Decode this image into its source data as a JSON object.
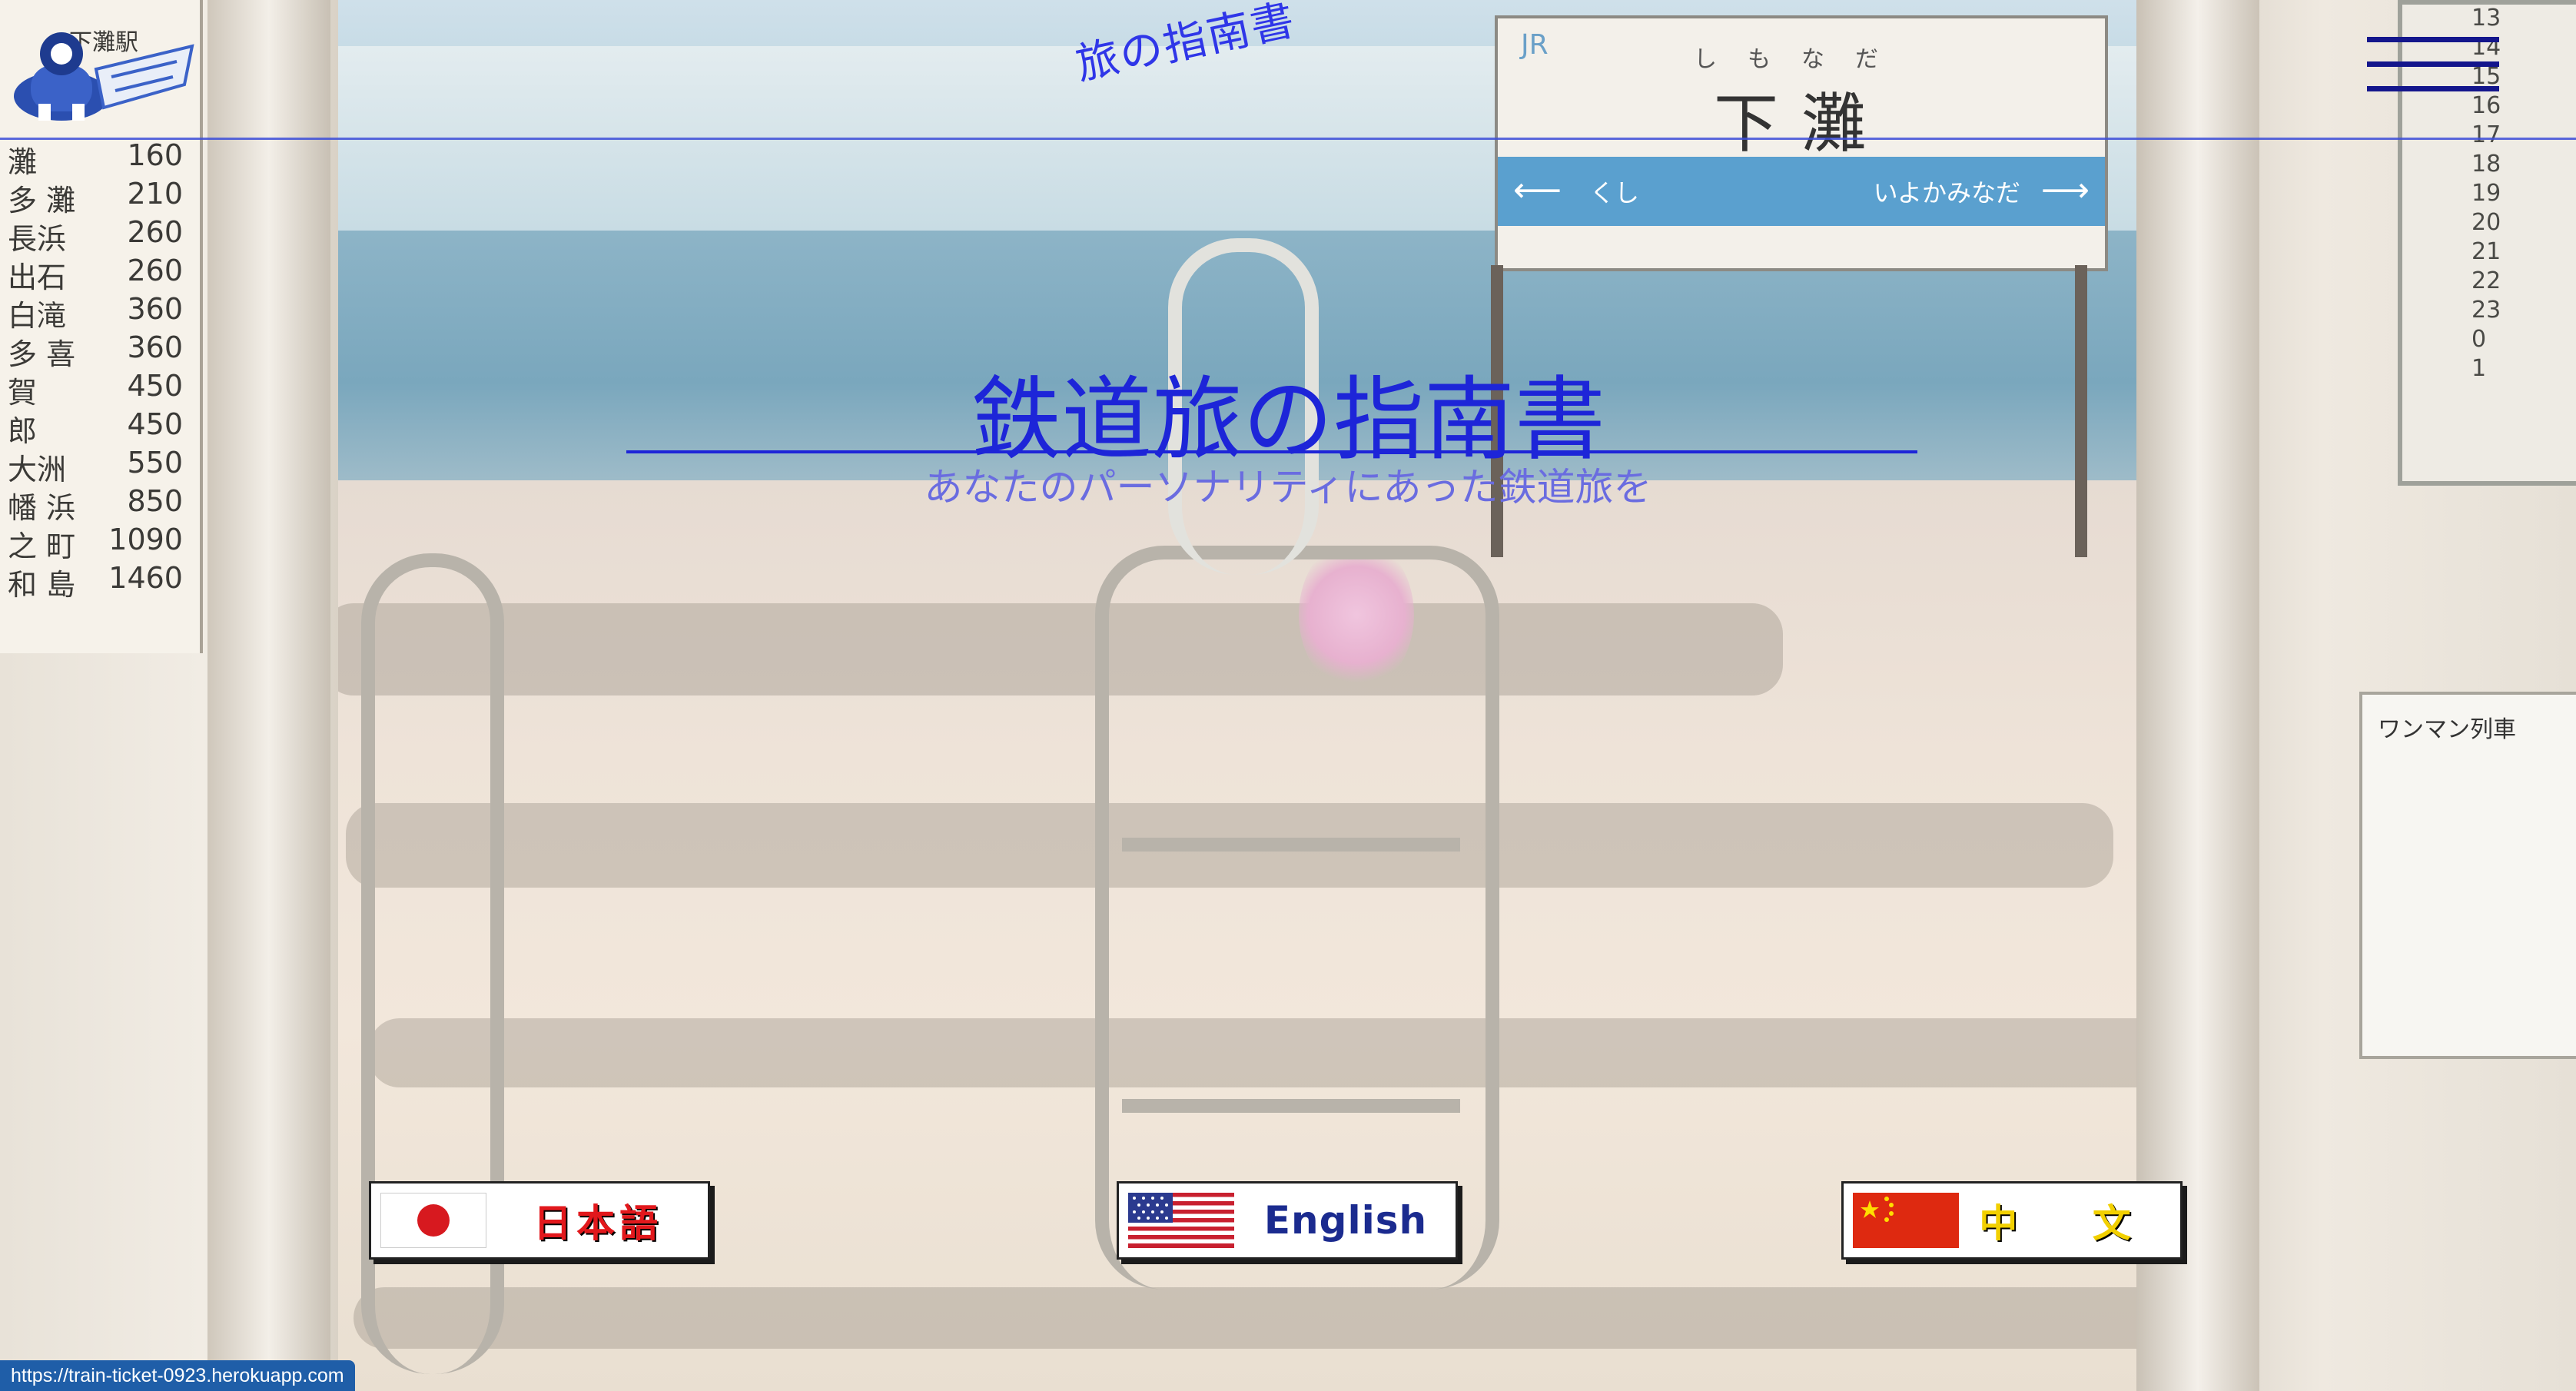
{
  "header": {
    "site_title": "旅の指南書",
    "menu_label": "メニュー"
  },
  "hero": {
    "title": "鉄道旅の指南書",
    "subtitle": "あなたのパーソナリティにあった鉄道旅を"
  },
  "languages": [
    {
      "label": "日本語",
      "flag": "japan-flag-icon"
    },
    {
      "label": "English",
      "flag": "usa-flag-icon"
    },
    {
      "label": "中 文",
      "flag": "china-flag-icon"
    }
  ],
  "background": {
    "station_sign": {
      "name": "下灘",
      "reading": "しもなだ",
      "line_mark": "JR",
      "left_dest": "くし",
      "right_dest": "いよかみなだ"
    },
    "fare_board": {
      "station": "下灘駅",
      "rows": [
        {
          "name": "灘",
          "fare": "160"
        },
        {
          "name": "多 灘",
          "fare": "210"
        },
        {
          "name": "長浜",
          "fare": "260"
        },
        {
          "name": "出石",
          "fare": "260"
        },
        {
          "name": "白滝",
          "fare": "360"
        },
        {
          "name": "多 喜",
          "fare": "360"
        },
        {
          "name": "賀",
          "fare": "450"
        },
        {
          "name": "郎",
          "fare": "450"
        },
        {
          "name": "大洲",
          "fare": "550"
        },
        {
          "name": "幡 浜",
          "fare": "850"
        },
        {
          "name": "之 町",
          "fare": "1090"
        },
        {
          "name": "和 島",
          "fare": "1460"
        }
      ]
    },
    "timetable_hours": [
      "13",
      "14",
      "15",
      "16",
      "17",
      "18",
      "19",
      "20",
      "21",
      "22",
      "23",
      "0",
      "1"
    ],
    "notice_title": "ワンマン列車"
  },
  "status": {
    "url": "https://train-ticket-0923.herokuapp.com"
  },
  "colors": {
    "title_blue": "#1d25d8",
    "subtitle_blue": "#6a6ce0",
    "menu_navy": "#14168c",
    "status_blue": "#1f5ea8"
  }
}
